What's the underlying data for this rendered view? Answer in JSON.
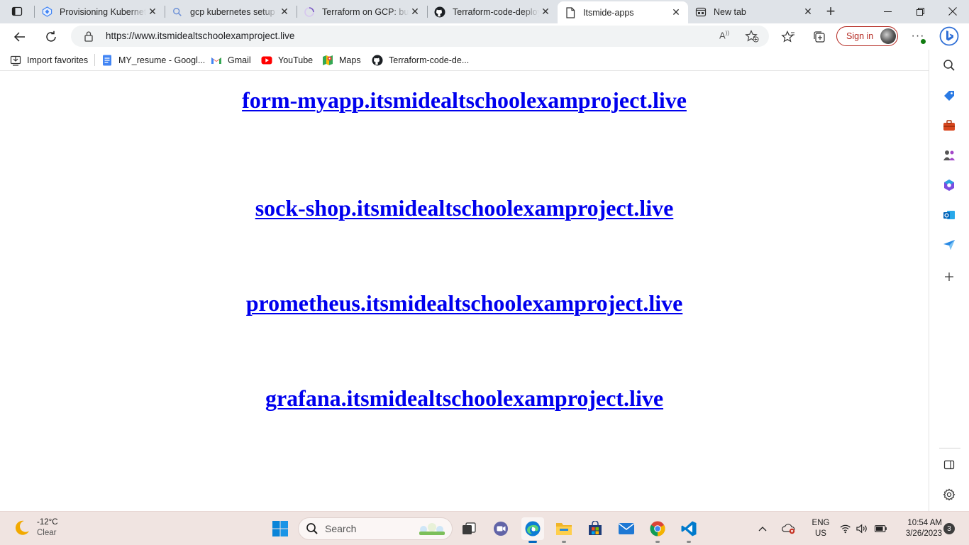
{
  "browser": {
    "tabs": [
      {
        "title": "Provisioning Kubernetes",
        "icon": "gke-icon",
        "active": false
      },
      {
        "title": "gcp kubernetes setup t",
        "icon": "search-icon",
        "active": false
      },
      {
        "title": "Terraform on GCP: buil",
        "icon": "loading-icon",
        "active": false
      },
      {
        "title": "Terraform-code-deploy",
        "icon": "github-icon",
        "active": false
      },
      {
        "title": "Itsmide-apps",
        "icon": "page-icon",
        "active": true
      },
      {
        "title": "New tab",
        "icon": "newtab-icon",
        "active": false
      }
    ],
    "address": {
      "url": "https://www.itsmidealtschoolexamproject.live"
    },
    "signin_label": "Sign in",
    "favorites": [
      {
        "label": "Import favorites",
        "icon": "import-icon"
      },
      {
        "label": "MY_resume - Googl...",
        "icon": "google-docs-icon"
      },
      {
        "label": "Gmail",
        "icon": "gmail-icon"
      },
      {
        "label": "YouTube",
        "icon": "youtube-icon"
      },
      {
        "label": "Maps",
        "icon": "maps-icon"
      },
      {
        "label": "Terraform-code-de...",
        "icon": "github-icon"
      }
    ]
  },
  "page": {
    "links": [
      "form-myapp.itsmidealtschoolexamproject.live",
      "sock-shop.itsmidealtschoolexamproject.live",
      "prometheus.itsmidealtschoolexamproject.live",
      "grafana.itsmidealtschoolexamproject.live"
    ],
    "link_color": "#0000ee"
  },
  "taskbar": {
    "weather": {
      "temp": "-12°C",
      "condition": "Clear"
    },
    "search_label": "Search",
    "language": {
      "line1": "ENG",
      "line2": "US"
    },
    "clock": {
      "time": "10:54 AM",
      "date": "3/26/2023"
    },
    "notification_count": "3"
  }
}
